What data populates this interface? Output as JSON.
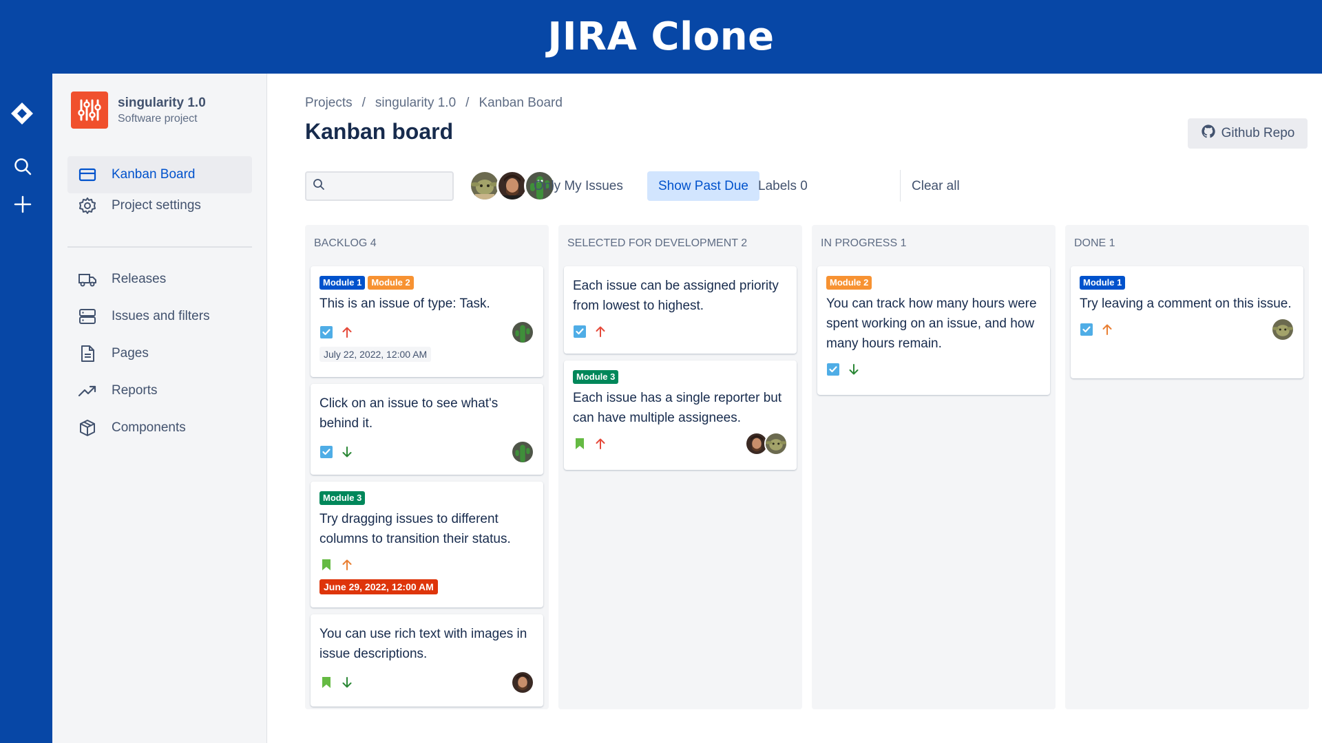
{
  "banner": {
    "title": "JIRA Clone"
  },
  "navbar": {
    "icons": [
      "jira-logo-icon",
      "search-icon",
      "plus-icon"
    ]
  },
  "project": {
    "name": "singularity 1.0",
    "type": "Software project"
  },
  "sidebar": {
    "items": [
      {
        "label": "Kanban Board",
        "icon": "board-icon",
        "active": true
      },
      {
        "label": "Project settings",
        "icon": "gear-icon"
      },
      {
        "label": "Releases",
        "icon": "truck-icon"
      },
      {
        "label": "Issues and filters",
        "icon": "server-icon"
      },
      {
        "label": "Pages",
        "icon": "page-icon"
      },
      {
        "label": "Reports",
        "icon": "trend-icon"
      },
      {
        "label": "Components",
        "icon": "box-icon"
      }
    ]
  },
  "breadcrumb": {
    "items": [
      "Projects",
      "singularity 1.0",
      "Kanban Board"
    ],
    "separator": "/"
  },
  "page_title": "Kanban board",
  "github_button": {
    "label": "Github Repo",
    "icon": "github-icon"
  },
  "filters": {
    "search_value": "",
    "only_my_issues": "Only My Issues",
    "show_past_due": "Show Past Due",
    "labels": "Labels 0",
    "clear_all": "Clear all"
  },
  "colors": {
    "brand": "#0747a6",
    "label_blue": "#0052cc",
    "label_orange": "#f79232",
    "label_green": "#00875a",
    "overdue": "#de350b",
    "priority_high": "#e5493a",
    "priority_medium": "#e97f33",
    "priority_low": "#2a8735"
  },
  "columns": [
    {
      "title": "BACKLOG 4",
      "cards": [
        {
          "labels": [
            {
              "text": "Module 1",
              "color": "blue"
            },
            {
              "text": "Module 2",
              "color": "orange"
            }
          ],
          "title": "This is an issue of type: Task.",
          "type": "task",
          "priority": "high",
          "assignees": [
            "cactus"
          ],
          "date": "July 22, 2022, 12:00 AM",
          "overdue": false
        },
        {
          "labels": [],
          "title": "Click on an issue to see what's behind it.",
          "type": "task",
          "priority": "low",
          "assignees": [
            "cactus"
          ]
        },
        {
          "labels": [
            {
              "text": "Module 3",
              "color": "green"
            }
          ],
          "title": "Try dragging issues to different columns to transition their status.",
          "type": "story",
          "priority": "medium",
          "assignees": [],
          "date": "June 29, 2022, 12:00 AM",
          "overdue": true
        },
        {
          "labels": [],
          "title": "You can use rich text with images in issue descriptions.",
          "type": "story",
          "priority": "low",
          "assignees": [
            "man"
          ]
        }
      ]
    },
    {
      "title": "SELECTED FOR DEVELOPMENT 2",
      "cards": [
        {
          "labels": [],
          "title": "Each issue can be assigned priority from lowest to highest.",
          "type": "task",
          "priority": "high",
          "assignees": []
        },
        {
          "labels": [
            {
              "text": "Module 3",
              "color": "green"
            }
          ],
          "title": "Each issue has a single reporter but can have multiple assignees.",
          "type": "story",
          "priority": "high",
          "assignees": [
            "man",
            "yoda"
          ]
        }
      ]
    },
    {
      "title": "IN PROGRESS 1",
      "cards": [
        {
          "labels": [
            {
              "text": "Module 2",
              "color": "orange"
            }
          ],
          "title": "You can track how many hours were spent working on an issue, and how many hours remain.",
          "type": "task",
          "priority": "low",
          "assignees": []
        }
      ]
    },
    {
      "title": "DONE 1",
      "cards": [
        {
          "labels": [
            {
              "text": "Module 1",
              "color": "blue"
            }
          ],
          "title": "Try leaving a comment on this issue.",
          "type": "task",
          "priority": "medium",
          "assignees": [
            "yoda"
          ]
        }
      ]
    }
  ]
}
